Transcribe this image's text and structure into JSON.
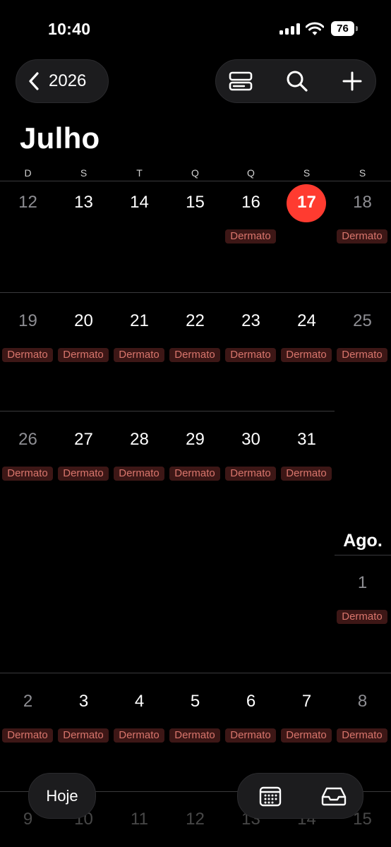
{
  "status_bar": {
    "time": "10:40",
    "battery": "76"
  },
  "header": {
    "year": "2026"
  },
  "month": {
    "title": "Julho"
  },
  "weekdays": [
    "D",
    "S",
    "T",
    "Q",
    "Q",
    "S",
    "S"
  ],
  "weeks": [
    {
      "days": [
        "12",
        "13",
        "14",
        "15",
        "16",
        "17",
        "18"
      ],
      "events": [
        "",
        "",
        "",
        "",
        "Dermato",
        "",
        "Dermato"
      ]
    },
    {
      "days": [
        "19",
        "20",
        "21",
        "22",
        "23",
        "24",
        "25"
      ],
      "events": [
        "Dermato",
        "Dermato",
        "Dermato",
        "Dermato",
        "Dermato",
        "Dermato",
        "Dermato"
      ]
    },
    {
      "days": [
        "26",
        "27",
        "28",
        "29",
        "30",
        "31"
      ],
      "events": [
        "Dermato",
        "Dermato",
        "Dermato",
        "Dermato",
        "Dermato",
        "Dermato"
      ]
    },
    {
      "days": [
        "2",
        "3",
        "4",
        "5",
        "6",
        "7",
        "8"
      ],
      "events": [
        "Dermato",
        "Dermato",
        "Dermato",
        "Dermato",
        "Dermato",
        "Dermato",
        "Dermato"
      ]
    },
    {
      "days": [
        "9",
        "10",
        "11",
        "12",
        "13",
        "14",
        "15"
      ]
    }
  ],
  "next_month": {
    "label": "Ago.",
    "day": "1",
    "event": "Dermato"
  },
  "today": "17",
  "bottom": {
    "today_button": "Hoje"
  },
  "icons": {
    "back": "chevron-left-icon",
    "list_view": "list-view-icon",
    "search": "search-icon",
    "add": "plus-icon",
    "calendars": "calendar-grid-icon",
    "inbox": "inbox-tray-icon"
  },
  "colors": {
    "today": "#ff3b30",
    "event_bg": "#3d1716",
    "event_text": "#d8756c"
  }
}
